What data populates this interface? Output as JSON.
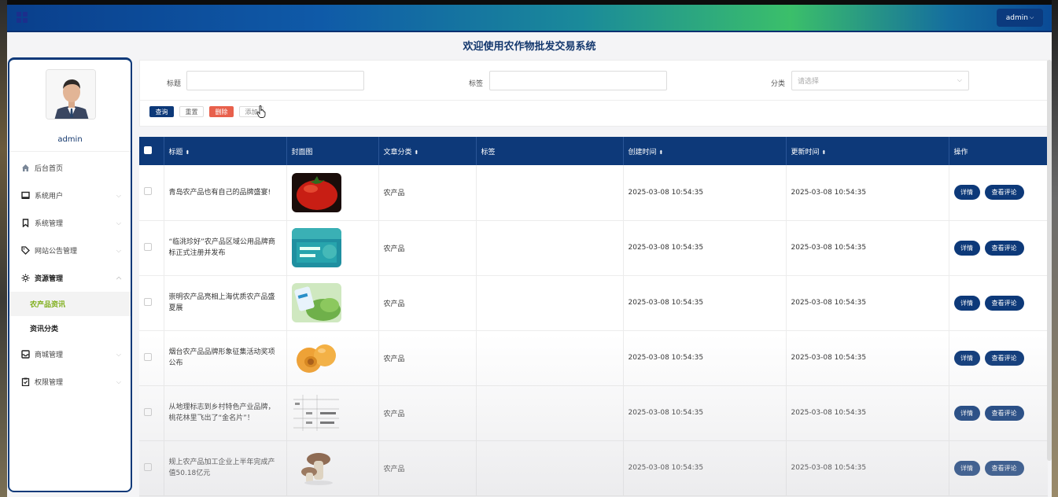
{
  "topbar": {
    "user_button": "admin"
  },
  "page_title": "欢迎使用农作物批发交易系统",
  "sidebar": {
    "username": "admin",
    "items": [
      {
        "label": "后台首页",
        "icon": "home-icon",
        "has_chevron": false
      },
      {
        "label": "系统用户",
        "icon": "monitor-icon",
        "has_chevron": true
      },
      {
        "label": "系统管理",
        "icon": "bookmark-icon",
        "has_chevron": true
      },
      {
        "label": "网站公告管理",
        "icon": "tag-icon",
        "has_chevron": true
      },
      {
        "label": "资源管理",
        "icon": "gear-icon",
        "has_chevron": true,
        "expanded": true
      }
    ],
    "sub_items": [
      {
        "label": "农产品资讯",
        "active": true
      },
      {
        "label": "资讯分类",
        "active": false
      }
    ],
    "items_after": [
      {
        "label": "商城管理",
        "icon": "inbox-icon",
        "has_chevron": true
      },
      {
        "label": "权限管理",
        "icon": "clipboard-icon",
        "has_chevron": true
      }
    ]
  },
  "search": {
    "title_label": "标题",
    "tag_label": "标签",
    "category_label": "分类",
    "category_placeholder": "请选择",
    "query_button": "查询",
    "reset_button": "重置",
    "delete_button": "删除",
    "add_button": "添加"
  },
  "table": {
    "headers": [
      "标题",
      "封面图",
      "文章分类",
      "标签",
      "创建时间",
      "更新时间",
      "操作"
    ],
    "detail_button": "详情",
    "comment_button": "查看评论",
    "rows": [
      {
        "title": "青岛农产品也有自己的品牌盛宴!",
        "cover": "tomato",
        "category": "农产品",
        "tag": "",
        "created": "2025-03-08 10:54:35",
        "updated": "2025-03-08 10:54:35"
      },
      {
        "title": "“临洮珍好”农产品区域公用品牌商标正式注册并发布",
        "cover": "brand",
        "category": "农产品",
        "tag": "",
        "created": "2025-03-08 10:54:35",
        "updated": "2025-03-08 10:54:35"
      },
      {
        "title": "崇明农产品亮相上海优质农产品盛夏展",
        "cover": "vegetables",
        "category": "农产品",
        "tag": "",
        "created": "2025-03-08 10:54:35",
        "updated": "2025-03-08 10:54:35"
      },
      {
        "title": "烟台农产品品牌形象征集活动奖项公布",
        "cover": "apricot",
        "category": "农产品",
        "tag": "",
        "created": "2025-03-08 10:54:35",
        "updated": "2025-03-08 10:54:35"
      },
      {
        "title": "从地理标志到乡村特色产业品牌，桃花林里飞出了“金名片”！",
        "cover": "table-doc",
        "category": "农产品",
        "tag": "",
        "created": "2025-03-08 10:54:35",
        "updated": "2025-03-08 10:54:35"
      },
      {
        "title": "规上农产品加工企业上半年完成产值50.18亿元",
        "cover": "mushroom",
        "category": "农产品",
        "tag": "",
        "created": "2025-03-08 10:54:35",
        "updated": "2025-03-08 10:54:35"
      }
    ]
  },
  "colors": {
    "primary": "#0d3979",
    "danger": "#e8604c",
    "active_sub": "#7fae1a"
  }
}
